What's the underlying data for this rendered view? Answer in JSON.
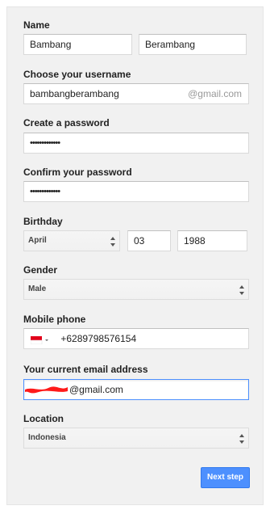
{
  "labels": {
    "name": "Name",
    "username": "Choose your username",
    "password": "Create a password",
    "confirm": "Confirm your password",
    "birthday": "Birthday",
    "gender": "Gender",
    "mobile": "Mobile phone",
    "email": "Your current email address",
    "location": "Location"
  },
  "fields": {
    "first_name": "Bambang",
    "last_name": "Berambang",
    "username": "bambangberambang",
    "username_suffix": "@gmail.com",
    "password": "•••••••••••••",
    "confirm_password": "•••••••••••••",
    "birth_month": "April",
    "birth_day": "03",
    "birth_year": "1988",
    "gender": "Male",
    "phone": "+6289798576154",
    "email_visible": "@gmail.com",
    "location": "Indonesia"
  },
  "buttons": {
    "next_step": "Next step"
  },
  "colors": {
    "accent": "#4d90fe",
    "redaction": "#ff0000"
  }
}
